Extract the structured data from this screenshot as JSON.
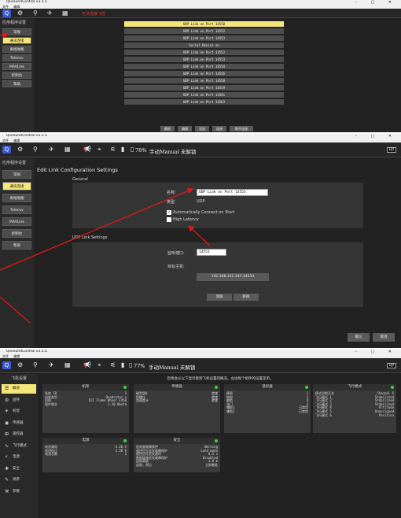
{
  "panel1": {
    "window_title": "QGroundControl v3.5.5",
    "menu": [
      "文件",
      "编辑"
    ],
    "status_text": "无法连接飞控",
    "side_title": "应用程序设置",
    "side_items": [
      {
        "label": "常规",
        "active": false
      },
      {
        "label": "通讯连接",
        "active": true
      },
      {
        "label": "离线地图",
        "active": false
      },
      {
        "label": "Telecev",
        "active": false
      },
      {
        "label": "MAVLink",
        "active": false
      },
      {
        "label": "控制台",
        "active": false
      },
      {
        "label": "帮助",
        "active": false
      }
    ],
    "links": [
      {
        "label": "UDP Link on Port 14550",
        "active": true
      },
      {
        "label": "UDP Link on Port 14552",
        "active": false
      },
      {
        "label": "UDP Link on Port 14553",
        "active": false
      },
      {
        "label": "Serial Device on",
        "active": false
      },
      {
        "label": "UDP Link on Port 14552",
        "active": false
      },
      {
        "label": "UDP Link on Port 14553",
        "active": false
      },
      {
        "label": "UDP Link on Port 14554",
        "active": false
      },
      {
        "label": "UDP Link on Port 14556",
        "active": false
      },
      {
        "label": "UDP Link on Port 14558",
        "active": false
      },
      {
        "label": "UDP Link on Port 14559",
        "active": false
      },
      {
        "label": "UDP Link on Port 14561",
        "active": false
      },
      {
        "label": "UDP Link on Port 14563",
        "active": false
      }
    ],
    "bottom_buttons": [
      "删除",
      "编辑",
      "添加",
      "连接",
      "断开连接"
    ]
  },
  "panel2": {
    "window_title": "QGroundControl v3.5.5",
    "menu": [
      "文件",
      "编辑"
    ],
    "battery_text": "78%",
    "mode_text": "手动Manual 未解锁",
    "logo_text": "DJI",
    "side_title": "应用程序设置",
    "side_items": [
      {
        "label": "常规",
        "active": false
      },
      {
        "label": "通讯连接",
        "active": true
      },
      {
        "label": "离线地图",
        "active": false
      },
      {
        "label": "Telecev",
        "active": false
      },
      {
        "label": "MAVLink",
        "active": false
      },
      {
        "label": "控制台",
        "active": false
      },
      {
        "label": "帮助",
        "active": false
      }
    ],
    "page_title": "Edit Link Configuration Settings",
    "general_label": "General",
    "name_label": "名称:",
    "name_value": "UDP Link on Port 14553",
    "type_label": "类型:",
    "type_value": "UDP",
    "auto_connect_label": "Automatically Connect on Start",
    "auto_connect_checked": true,
    "high_latency_label": "High Latency",
    "high_latency_checked": false,
    "udp_settings_label": "UDP Link Settings",
    "listen_port_label": "监听端口:",
    "listen_port_value": "14553",
    "target_host_label": "目标主机:",
    "target_host_value": "192.168.101.197:14553",
    "add_button": "添加",
    "remove_button": "移除",
    "ok_button": "确认",
    "cancel_button": "取消"
  },
  "panel3": {
    "window_title": "QGroundControl v3.5.5",
    "menu": [
      "文件",
      "编辑"
    ],
    "battery_text": "77%",
    "mode_text": "手动Manual 未解锁",
    "logo_text": "DJI",
    "side_title": "飞机设置",
    "side_items": [
      {
        "label": "概况",
        "icon": "☰",
        "active": true
      },
      {
        "label": "固件",
        "icon": "⚙",
        "active": false
      },
      {
        "label": "机架",
        "icon": "✈",
        "active": false
      },
      {
        "label": "传感器",
        "icon": "◉",
        "active": false
      },
      {
        "label": "遥控器",
        "icon": "⊞",
        "active": false
      },
      {
        "label": "飞行模式",
        "icon": "∿",
        "active": false
      },
      {
        "label": "电源",
        "icon": "⚡",
        "active": false
      },
      {
        "label": "安全",
        "icon": "✚",
        "active": false
      },
      {
        "label": "调参",
        "icon": "✎",
        "active": false
      },
      {
        "label": "参数",
        "icon": "⚒",
        "active": false
      }
    ],
    "intro": "您将会从以下显示看到飞机设置的概况。左边每个组件的设置菜单。",
    "tiles": [
      {
        "title": "机架",
        "rows": [
          [
            "系统 ID",
            "1"
          ],
          [
            "机架类型",
            "Quadrotor x"
          ],
          [
            "机体",
            "DJI Flame Wheel F450"
          ],
          [
            "固件版本",
            "1.10.0beta"
          ]
        ]
      },
      {
        "title": "传感器",
        "rows": [
          [
            "磁罗盘0",
            "就绪"
          ],
          [
            "陀螺仪",
            "就绪"
          ],
          [
            "加速度计",
            "就绪"
          ]
        ]
      },
      {
        "title": "遥控器",
        "rows": [
          [
            "横滚",
            "1"
          ],
          [
            "俯仰",
            "2"
          ],
          [
            "偏航",
            "4"
          ],
          [
            "油门",
            "3"
          ],
          [
            "辅助1",
            "已禁用"
          ],
          [
            "辅助2",
            "已禁用"
          ]
        ]
      },
      {
        "title": "飞行模式",
        "rows": [
          [
            "模式切换开关",
            "Channel 5"
          ],
          [
            "飞行模式 1",
            "Stabilized"
          ],
          [
            "飞行模式 2",
            "Stabilized"
          ],
          [
            "飞行模式 3",
            "Stabilized"
          ],
          [
            "飞行模式 4",
            "Altitude"
          ],
          [
            "飞行模式 5",
            "Unassigned"
          ],
          [
            "飞行模式 6",
            "Position"
          ]
        ]
      },
      {
        "title": "电源",
        "rows": [
          [
            "电池满电",
            "4.20 V"
          ],
          [
            "电池低压",
            "3.50 V"
          ],
          [
            "电池芯数",
            "3"
          ]
        ]
      },
      {
        "title": "安全",
        "rows": [
          [
            "低电量故障保护",
            "Warning"
          ],
          [
            "遥控信号丢失故障保护",
            "Land mode"
          ],
          [
            "遥控信号丢失超时",
            "0.5 s"
          ],
          [
            "数据链路丢失故障保护",
            "Disabled"
          ],
          [
            "返航高度",
            "1.0 m"
          ],
          [
            "返航，然后",
            "立即着陆"
          ]
        ]
      }
    ]
  }
}
